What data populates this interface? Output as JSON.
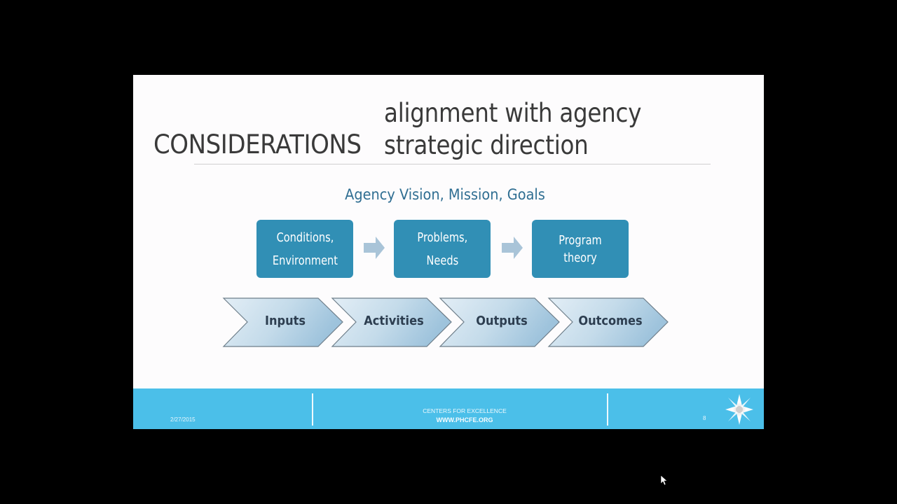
{
  "slide": {
    "title": "CONSIDERATIONS",
    "subtitle_line1": "alignment with agency",
    "subtitle_line2": "strategic direction",
    "agency_heading": "Agency Vision, Mission, Goals",
    "flow_boxes": [
      {
        "line1": "Conditions,",
        "line2": "Environment"
      },
      {
        "line1": "Problems,",
        "line2": "Needs"
      },
      {
        "line1": "Program",
        "line2": "theory"
      }
    ],
    "chevrons": [
      "Inputs",
      "Activities",
      "Outputs",
      "Outcomes"
    ],
    "colors": {
      "box": "#318fb5",
      "heading": "#2f6e92",
      "footer": "#4bbfe9",
      "arrow": "#a9c4d8"
    }
  },
  "footer": {
    "date": "2/27/2015",
    "org": "CENTERS FOR EXCELLENCE",
    "url": "WWW.PHCFE.ORG",
    "page_number": "8",
    "logo_icon": "star-burst-logo"
  }
}
